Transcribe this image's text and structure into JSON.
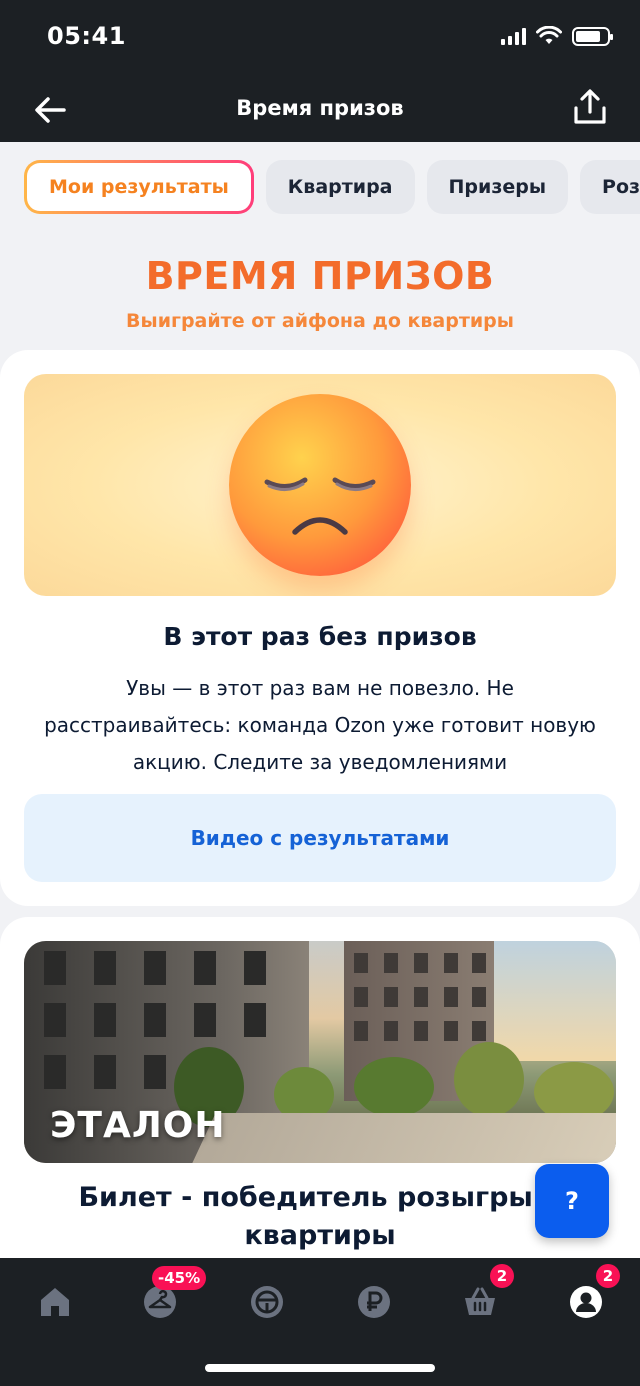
{
  "status_bar": {
    "time": "05:41"
  },
  "nav": {
    "title": "Время призов"
  },
  "tabs": [
    {
      "label": "Мои результаты",
      "active": true
    },
    {
      "label": "Квартира",
      "active": false
    },
    {
      "label": "Призеры",
      "active": false
    },
    {
      "label": "Розыгры",
      "active": false
    }
  ],
  "hero": {
    "title": "ВРЕМЯ ПРИЗОВ",
    "subtitle": "Выиграйте от айфона до квартиры"
  },
  "result_card": {
    "title": "В этот раз без призов",
    "text_line1": "Увы — в этот раз вам не повезло. Не",
    "text_line2": "расстраивайтесь: команда Ozon уже готовит новую",
    "text_line3": "акцию. Следите за уведомлениями",
    "button": "Видео с результатами"
  },
  "apartment_card": {
    "brand": "ЭТАЛОН",
    "title_line1": "Билет - победитель розыгрыш",
    "title_line2": "квартиры"
  },
  "help": {
    "label": "?"
  },
  "tabbar": {
    "discount_badge": "-45%",
    "cart_badge": "2",
    "profile_badge": "2"
  },
  "colors": {
    "accent_orange": "#f36c2b",
    "link_blue": "#1562d6",
    "badge_pink": "#f91155",
    "help_blue": "#0b5dee"
  }
}
